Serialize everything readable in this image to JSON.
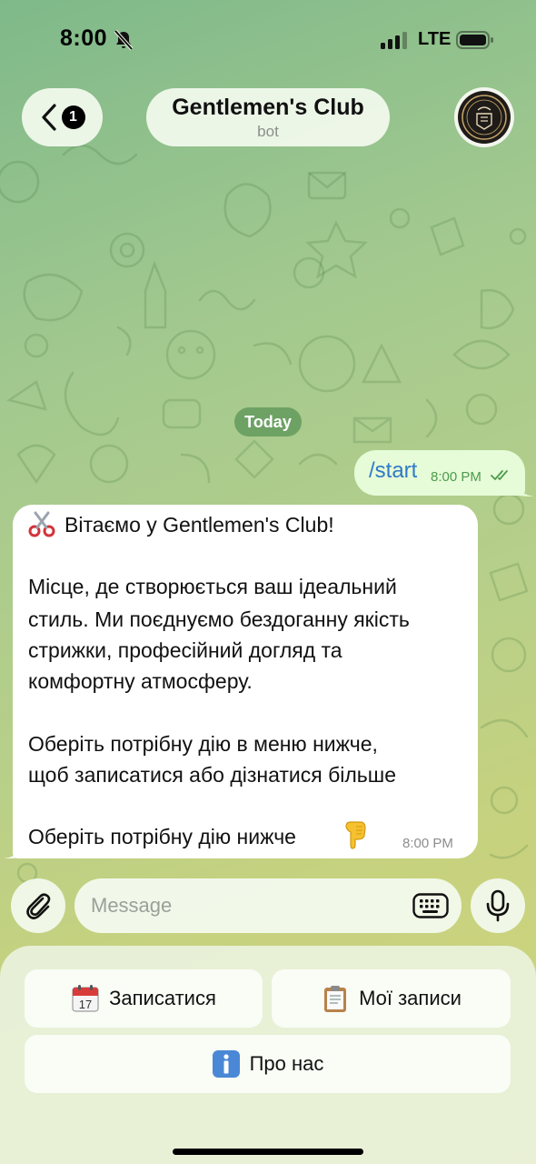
{
  "status_bar": {
    "time": "8:00",
    "network": "LTE"
  },
  "header": {
    "unread_count": "1",
    "title": "Gentlemen's Club",
    "subtitle": "bot"
  },
  "date_separator": "Today",
  "messages": {
    "outgoing": {
      "text": "/start",
      "time": "8:00 PM",
      "status": "read"
    },
    "incoming": {
      "lines": [
        "Вітаємо у Gentlemen's Club!",
        "Місце, де створюється ваш ідеальний",
        "стиль. Ми поєднуємо бездоганну якість",
        "стрижки, професійний догляд та",
        "комфортну атмосферу.",
        "Оберіть потрібну дію в меню нижче,",
        "щоб записатися або дізнатися більше",
        "Оберіть потрібну дію нижче"
      ],
      "time": "8:00 PM"
    }
  },
  "composer": {
    "placeholder": "Message"
  },
  "reply_keyboard": {
    "book": {
      "label": "Записатися",
      "icon": "calendar-icon",
      "calendar_day": "17"
    },
    "records": {
      "label": "Мої записи",
      "icon": "clipboard-icon"
    },
    "about": {
      "label": "Про нас",
      "icon": "info-icon"
    }
  },
  "colors": {
    "outgoing_bubble": "#e6fbd7",
    "link_blue": "#2f7ac8",
    "date_chip": "#5c9658",
    "time_green": "#4e9a4e"
  }
}
